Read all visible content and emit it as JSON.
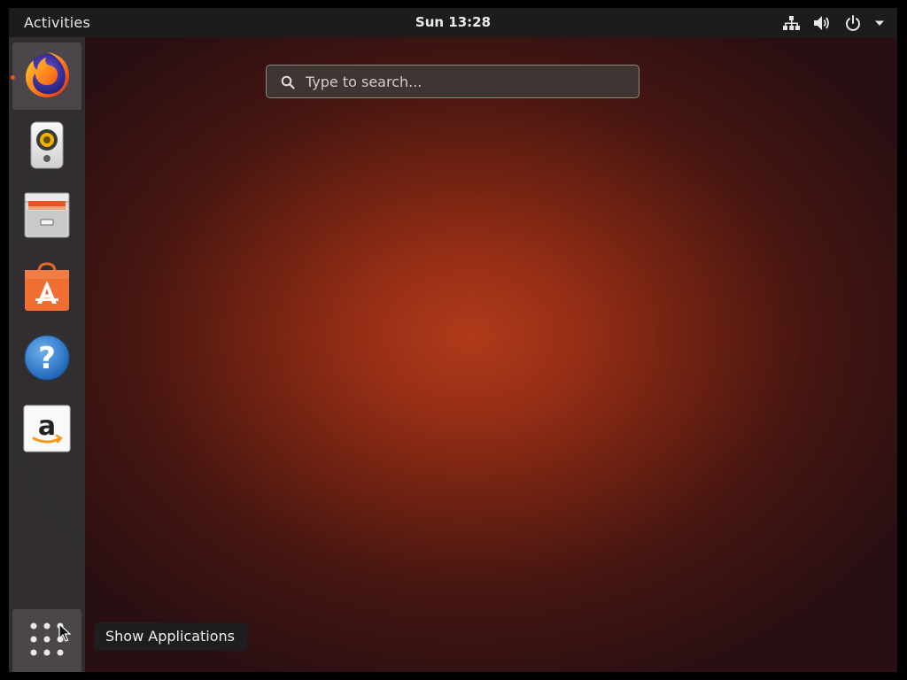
{
  "topbar": {
    "activities_label": "Activities",
    "clock": "Sun 13:28",
    "tray_icons": [
      "network-icon",
      "volume-icon",
      "power-icon",
      "chevron-down-icon"
    ]
  },
  "search": {
    "placeholder": "Type to search..."
  },
  "dock": {
    "items": [
      {
        "name": "Firefox",
        "icon": "firefox-icon",
        "running": true
      },
      {
        "name": "Rhythmbox",
        "icon": "rhythmbox-icon",
        "running": false
      },
      {
        "name": "Files",
        "icon": "files-icon",
        "running": false
      },
      {
        "name": "Ubuntu Software",
        "icon": "software-center-icon",
        "running": false
      },
      {
        "name": "Help",
        "icon": "help-icon",
        "running": false
      },
      {
        "name": "Amazon",
        "icon": "amazon-icon",
        "running": false
      }
    ],
    "show_apps_icon": "app-grid-icon"
  },
  "tooltip": {
    "text": "Show Applications"
  },
  "colors": {
    "topbar_bg": "#1d1c1a",
    "accent_orange": "#e95420",
    "wallpaper_center": "#b03a1a"
  }
}
